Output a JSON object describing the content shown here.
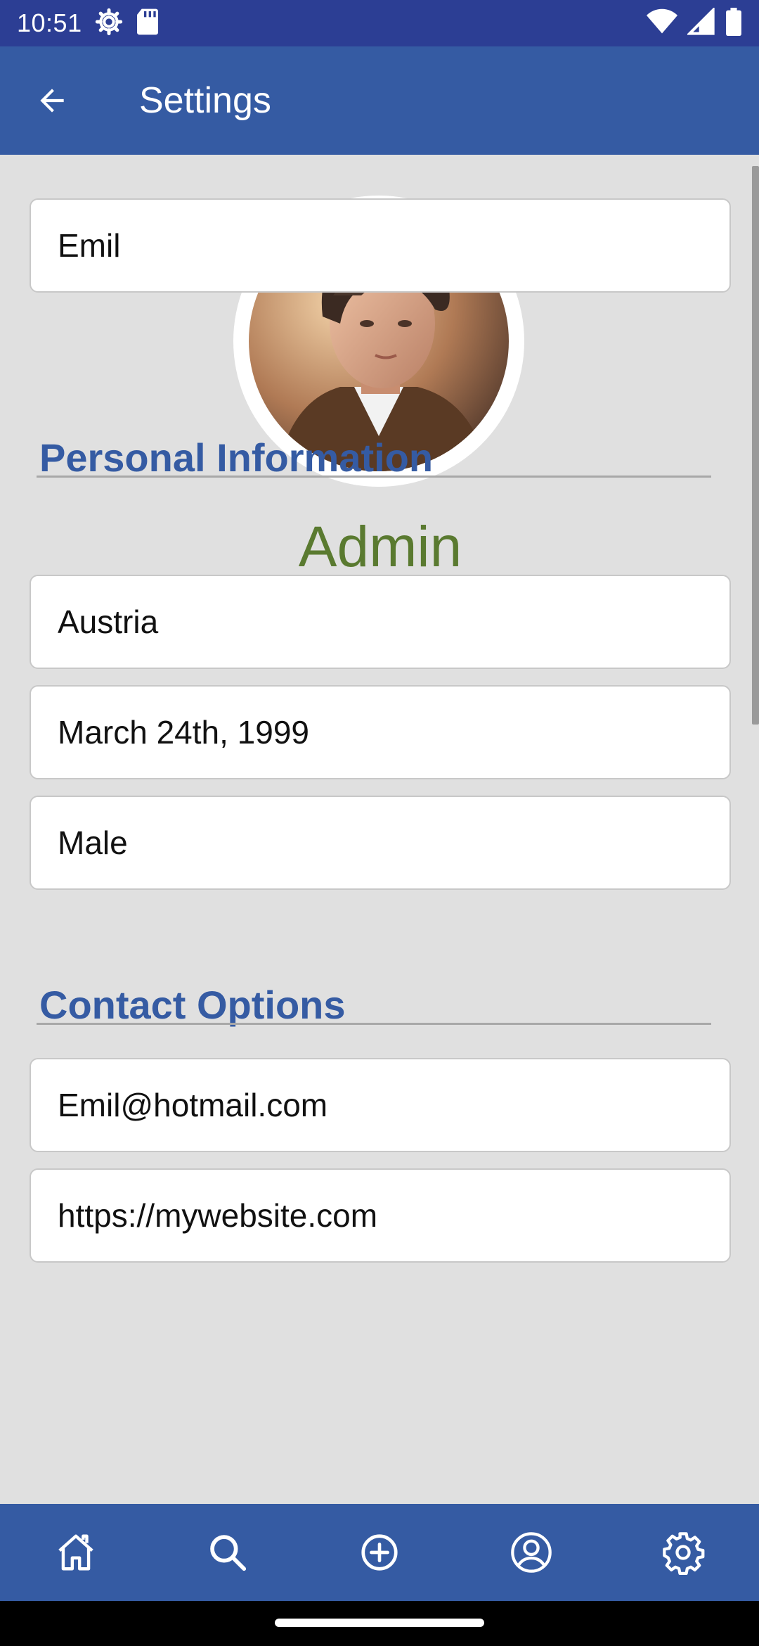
{
  "status_bar": {
    "time": "10:51",
    "icons": [
      "settings-gear-icon",
      "sd-card-icon",
      "wifi-icon",
      "cellular-signal-icon",
      "battery-icon"
    ]
  },
  "app_bar": {
    "title": "Settings",
    "back_icon": "arrow-left-icon"
  },
  "profile": {
    "avatar_icon": "profile-photo",
    "username": "Admin"
  },
  "personal_information": {
    "title": "Personal Information",
    "fields": [
      {
        "name": "first-name",
        "value": "Emil"
      },
      {
        "name": "country",
        "value": "Austria"
      },
      {
        "name": "birth-date",
        "value": "March 24th, 1999"
      },
      {
        "name": "gender",
        "value": "Male"
      }
    ]
  },
  "contact_options": {
    "title": "Contact Options",
    "fields": [
      {
        "name": "email",
        "value": "Emil@hotmail.com"
      },
      {
        "name": "website",
        "value": "https://mywebsite.com"
      }
    ]
  },
  "bottom_nav": {
    "items": [
      "home-icon",
      "search-icon",
      "add-circle-icon",
      "account-circle-icon",
      "settings-icon"
    ]
  },
  "colors": {
    "status_bar": "#2c3e94",
    "app_bar": "#355ba3",
    "background": "#e0e0e0",
    "username": "#5a7a30",
    "section_title": "#355ba3"
  }
}
